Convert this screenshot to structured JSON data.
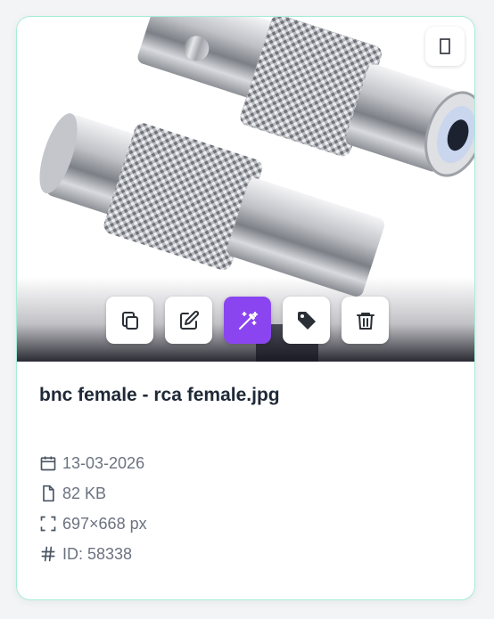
{
  "file": {
    "name": "bnc female - rca female.jpg",
    "date": "13-03-2026",
    "size": "82 KB",
    "dimensions": "697×668 px",
    "id_label": "ID: 58338"
  },
  "actions": [
    {
      "icon": "copy-icon"
    },
    {
      "icon": "edit-icon"
    },
    {
      "icon": "magic-wand-icon",
      "active": true
    },
    {
      "icon": "tag-icon"
    },
    {
      "icon": "trash-icon"
    }
  ],
  "colors": {
    "accent": "#8b45f0",
    "card_border": "#a7ecd9",
    "title": "#1f2937",
    "meta_text": "#6b7280"
  }
}
